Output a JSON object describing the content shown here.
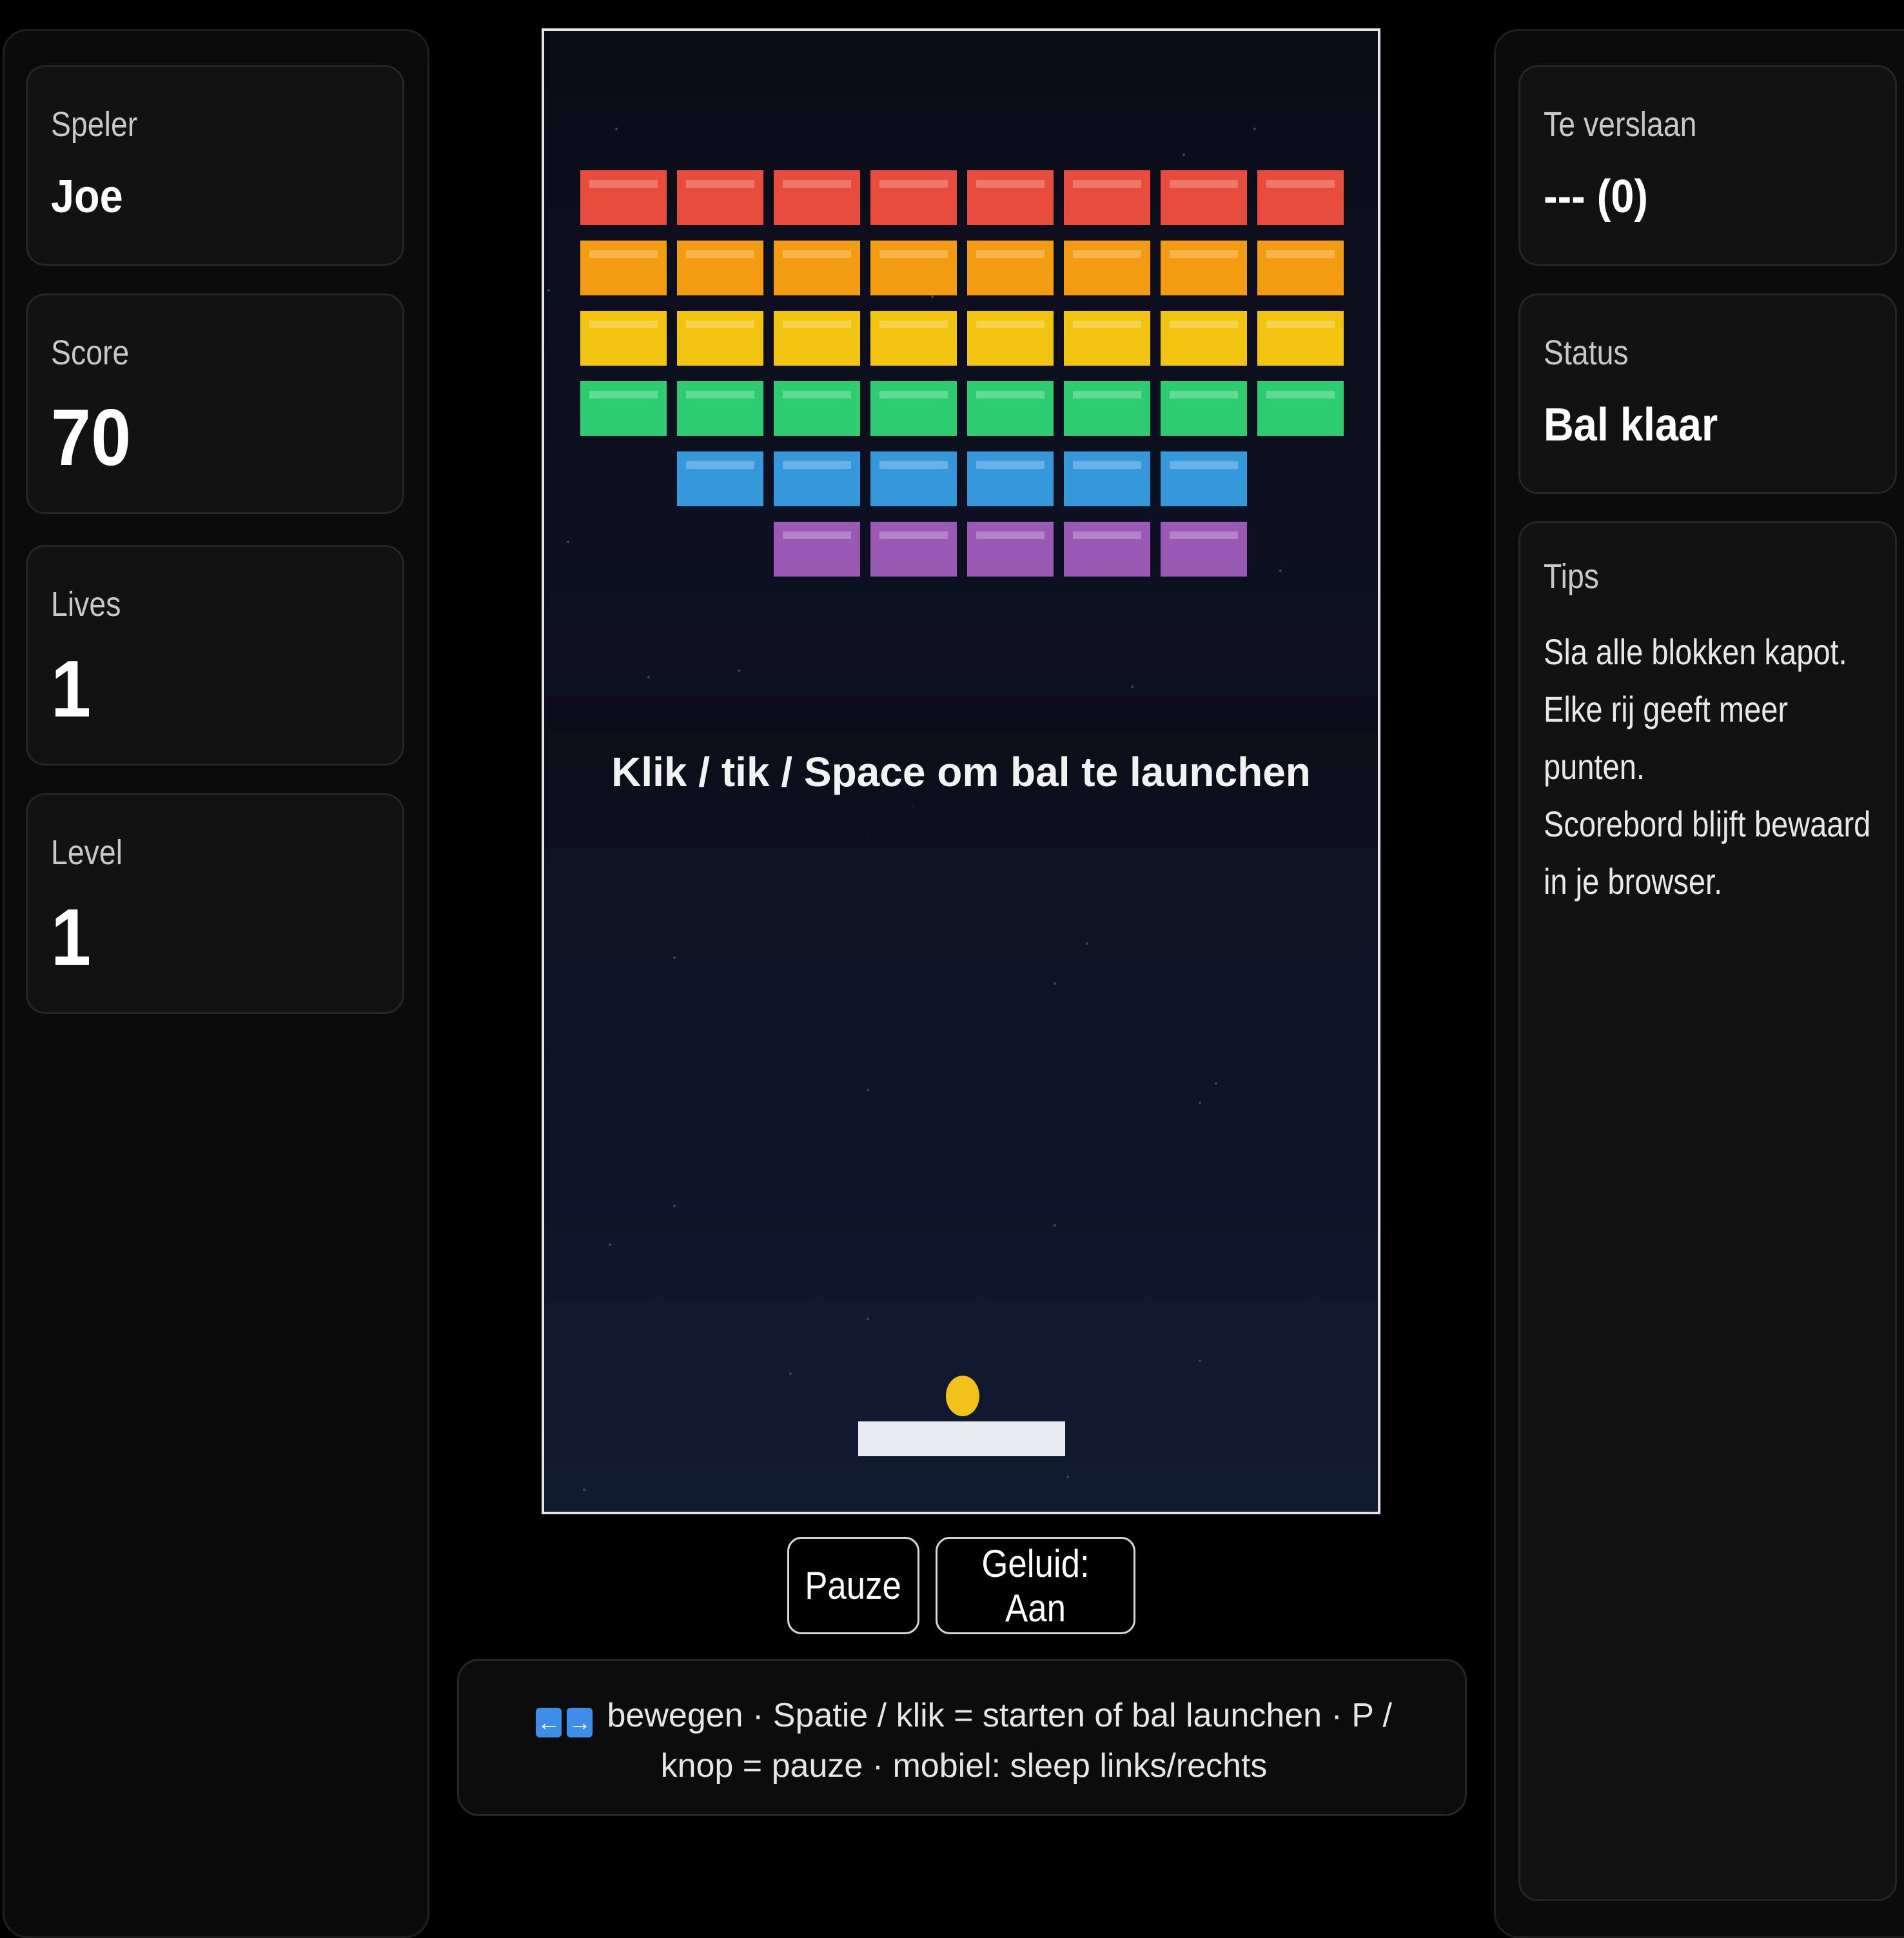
{
  "player": {
    "label": "Speler",
    "value": "Joe"
  },
  "score": {
    "label": "Score",
    "value": "70"
  },
  "lives": {
    "label": "Lives",
    "value": "1"
  },
  "level": {
    "label": "Level",
    "value": "1"
  },
  "to_beat": {
    "label": "Te verslaan",
    "value": "--- (0)"
  },
  "status": {
    "label": "Status",
    "value": "Bal klaar"
  },
  "tips": {
    "label": "Tips",
    "lines": [
      "Sla alle blokken kapot.",
      "Elke rij geeft meer punten.",
      "Scorebord blijft bewaard in je browser."
    ]
  },
  "game": {
    "banner": "Klik / tik / Space om bal te launchen",
    "brick_rows": [
      {
        "color": "#e74c3c",
        "count": 8
      },
      {
        "color": "#f39c12",
        "count": 8
      },
      {
        "color": "#f1c40f",
        "count": 8
      },
      {
        "color": "#2ecc71",
        "count": 8
      },
      {
        "color": "#3498db",
        "count": 6
      },
      {
        "color": "#9b59b6",
        "count": 5
      }
    ],
    "ball_color": "#f2c218",
    "paddle_color": "#e9ecef"
  },
  "buttons": {
    "pause": "Pauze",
    "sound": "Geluid: Aan"
  },
  "help": {
    "left_key_icon": "←",
    "right_key_icon": "→",
    "text": "bewegen · Spatie / klik = starten of bal launchen · P / knop = pauze · mobiel: sleep links/rechts"
  }
}
